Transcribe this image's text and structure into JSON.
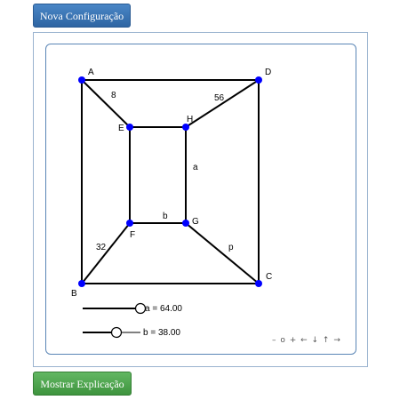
{
  "buttons": {
    "new_config": "Nova Configuração",
    "show_explanation": "Mostrar Explicação"
  },
  "graph": {
    "vertices": {
      "A": "A",
      "B": "B",
      "C": "C",
      "D": "D",
      "E": "E",
      "F": "F",
      "G": "G",
      "H": "H"
    },
    "edge_labels": {
      "AE": "8",
      "DH": "56",
      "HG": "a",
      "FG": "b",
      "BF": "32",
      "GC": "p"
    }
  },
  "sliders": {
    "a": {
      "label": "a = 64.00",
      "value": 64.0
    },
    "b": {
      "label": "b = 38.00",
      "value": 38.0
    }
  },
  "nav_controls": "– o + ← ↓ ↑ →",
  "colors": {
    "vertex": "#0000ff",
    "edge": "#000000",
    "primary_button": "#3a74b4",
    "success_button": "#4aa34a"
  }
}
